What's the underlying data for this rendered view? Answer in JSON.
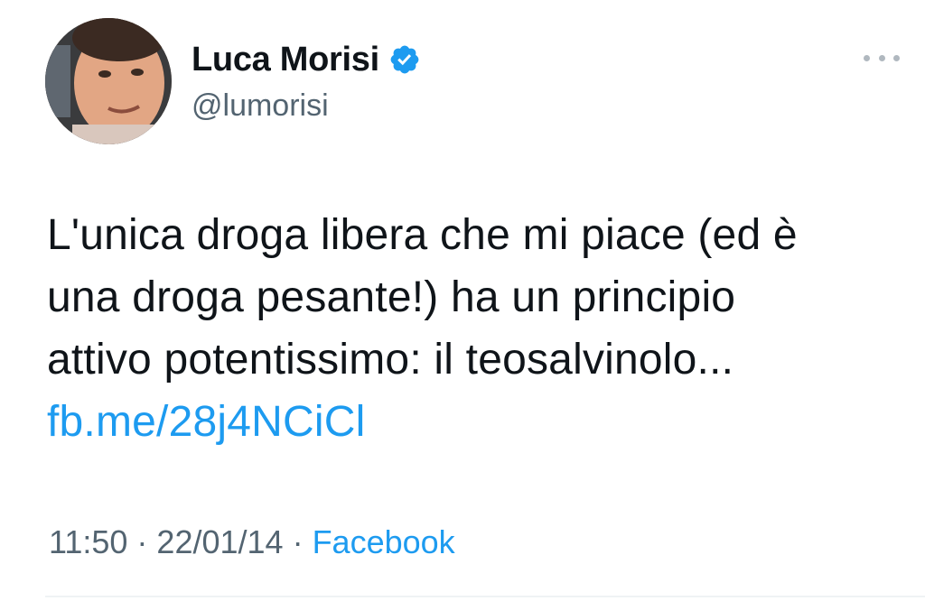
{
  "author": {
    "display_name": "Luca Morisi",
    "handle": "@lumorisi",
    "verified": true,
    "avatar_icon": "profile-photo"
  },
  "tweet": {
    "text_lines": [
      "L'unica droga libera che mi piace (ed è",
      "una droga pesante!) ha un principio",
      "attivo potentissimo: il teosalvinolo..."
    ],
    "link": "fb.me/28j4NCiCl"
  },
  "meta": {
    "time": "11:50",
    "date": "22/01/14",
    "separator": "·",
    "source": "Facebook"
  },
  "icons": {
    "more": "more-icon",
    "verified": "verified-badge-icon"
  },
  "colors": {
    "link": "#1d9bf0",
    "secondary_text": "#536471",
    "verified": "#1d9bf0"
  }
}
